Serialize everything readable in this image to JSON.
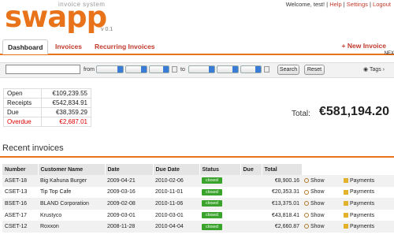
{
  "app": {
    "name": "swapp",
    "subtitle": "invoice system",
    "version": "v 0.1"
  },
  "topnav": {
    "welcome": "Welcome, test!",
    "sep": "|",
    "help": "Help",
    "settings": "Settings",
    "logout": "Logout"
  },
  "tabs": {
    "dashboard": "Dashboard",
    "invoices": "Invoices",
    "recurring": "Recurring Invoices",
    "new_invoice": "+ New Invoice",
    "overflow": "NEX"
  },
  "filter": {
    "search_value": "",
    "from_label": "from",
    "to_label": "to",
    "search_button": "Search",
    "reset_button": "Reset",
    "tags_label": "Tags ›"
  },
  "stats": [
    {
      "label": "Open",
      "value": "€109,239.55"
    },
    {
      "label": "Receipts",
      "value": "€542,834.91"
    },
    {
      "label": "Due",
      "value": "€38,359.29"
    },
    {
      "label": "Overdue",
      "value": "€2,687.01"
    }
  ],
  "total": {
    "label": "Total:",
    "value": "€581,194.20"
  },
  "recent": {
    "title": "Recent invoices",
    "columns": [
      "Number",
      "Customer Name",
      "Date",
      "Due Date",
      "Status",
      "Due",
      "Total"
    ],
    "rows": [
      {
        "number": "ASET-18",
        "customer": "Big Kahuna Burger",
        "date": "2009-04-21",
        "due_date": "2010-02-06",
        "status": "closed",
        "due": "",
        "total": "€8,900.16"
      },
      {
        "number": "CSET-13",
        "customer": "Tip Top Cafe",
        "date": "2009-03-16",
        "due_date": "2010-11-01",
        "status": "closed",
        "due": "",
        "total": "€20,353.31"
      },
      {
        "number": "BSET-16",
        "customer": "BLAND Corporation",
        "date": "2009-02-08",
        "due_date": "2010-11-06",
        "status": "closed",
        "due": "",
        "total": "€13,375.01"
      },
      {
        "number": "ASET-17",
        "customer": "Krustyco",
        "date": "2009-03-01",
        "due_date": "2010-03-01",
        "status": "closed",
        "due": "",
        "total": "€43,818.41"
      },
      {
        "number": "CSET-12",
        "customer": "Roxxon",
        "date": "2008-11-28",
        "due_date": "2010-04-04",
        "status": "closed",
        "due": "",
        "total": "€2,660.87"
      }
    ],
    "show_label": "Show",
    "payments_label": "Payments"
  },
  "colors": {
    "accent": "#e8731a",
    "link": "#c0392b",
    "status_closed": "#3aa32c",
    "overdue": "#dd0000"
  }
}
